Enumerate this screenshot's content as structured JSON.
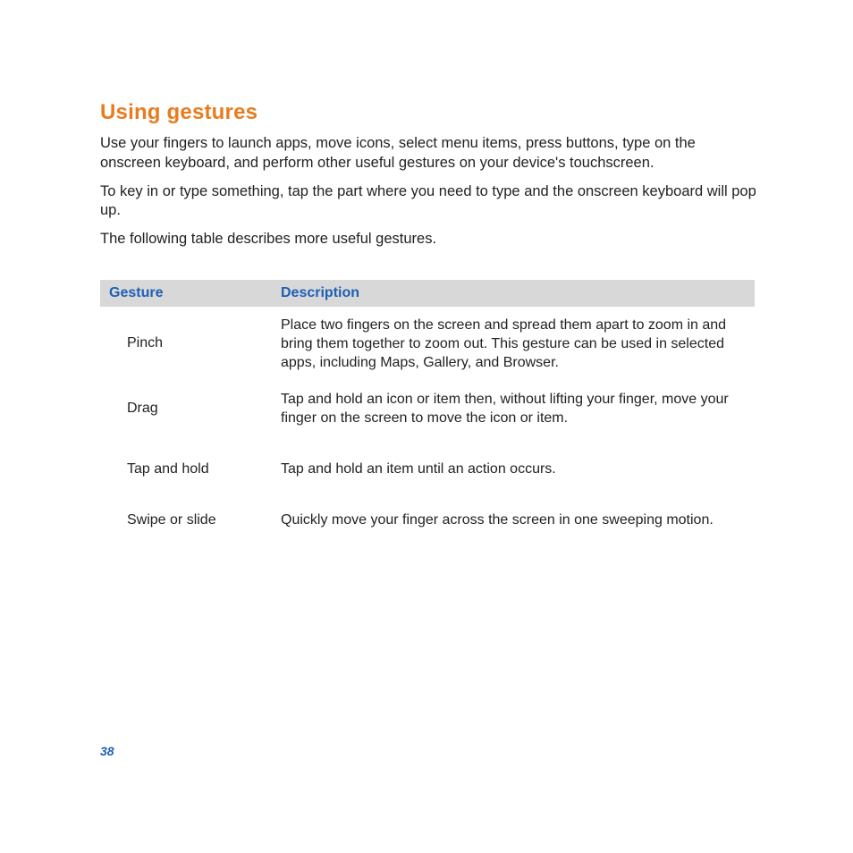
{
  "title": "Using gestures",
  "paras": [
    "Use your fingers to launch apps, move icons, select menu items, press buttons, type on the onscreen keyboard, and perform other useful gestures on your device's touchscreen.",
    "To key in or type something, tap the part where you need to type and the onscreen keyboard will pop up.",
    "The following table describes more useful gestures."
  ],
  "table": {
    "header_gesture": "Gesture",
    "header_description": "Description",
    "rows": [
      {
        "gesture": "Pinch",
        "description": "Place two fingers on the screen and spread them apart to zoom in and bring them together to zoom out. This gesture can be used in selected apps, including Maps, Gallery, and Browser."
      },
      {
        "gesture": "Drag",
        "description": "Tap and hold an icon or item then, without lifting your finger, move your finger on the screen to move the icon or item."
      },
      {
        "gesture": "Tap and hold",
        "description": "Tap and hold an item until an action occurs."
      },
      {
        "gesture": "Swipe or slide",
        "description": "Quickly move your finger across the screen in one sweeping motion."
      }
    ]
  },
  "page_number": "38"
}
